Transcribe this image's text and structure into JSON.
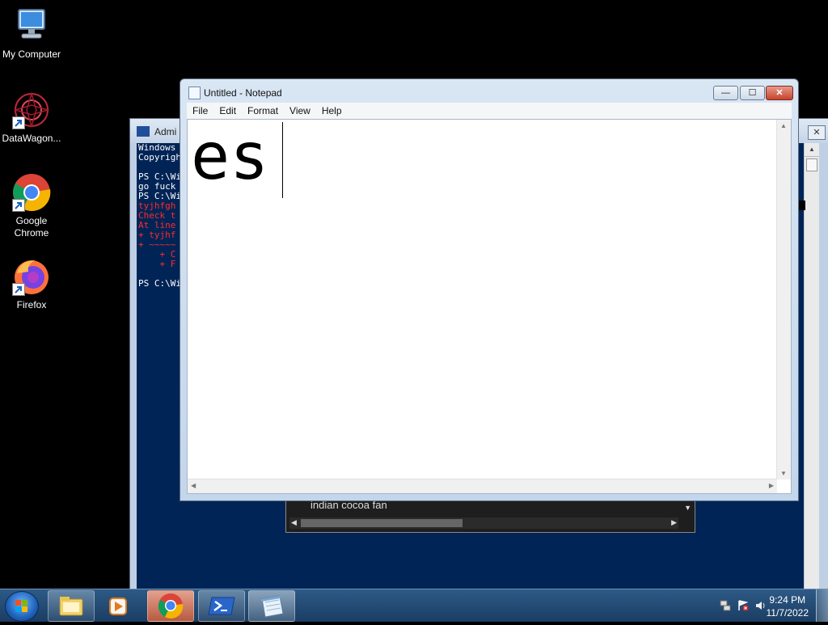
{
  "desktop": {
    "icons": [
      {
        "label": "My Computer",
        "icon": "computer-icon"
      },
      {
        "label": "DataWagon...",
        "icon": "datawagon-icon"
      },
      {
        "label": "Google Chrome",
        "icon": "chrome-icon"
      },
      {
        "label": "Firefox",
        "icon": "firefox-icon"
      }
    ]
  },
  "powershell": {
    "title": "Admi",
    "close": "✕",
    "lines": [
      {
        "text": "Windows",
        "color": "#ffffff"
      },
      {
        "text": "Copyrigh",
        "color": "#ffffff"
      },
      {
        "text": "",
        "color": "#ffffff"
      },
      {
        "text": "PS C:\\Wi",
        "color": "#ffffff"
      },
      {
        "text": "go fuck",
        "color": "#ffffff"
      },
      {
        "text": "PS C:\\Wi",
        "color": "#ffffff"
      },
      {
        "text": "tyjhfgh",
        "color": "#ff2b2b"
      },
      {
        "text": "Check t",
        "color": "#ff2b2b"
      },
      {
        "text": "At line",
        "color": "#ff2b2b"
      },
      {
        "text": "+ tyjhf",
        "color": "#ff2b2b"
      },
      {
        "text": "+ ~~~~~",
        "color": "#ff2b2b"
      },
      {
        "text": "    + C",
        "color": "#ff2b2b"
      },
      {
        "text": "    + F",
        "color": "#ff2b2b"
      },
      {
        "text": "",
        "color": "#ffffff"
      },
      {
        "text": "PS C:\\Wi",
        "color": "#ffffff"
      }
    ]
  },
  "autocomplete": {
    "text": "indian cocoa fan"
  },
  "notepad": {
    "title": "Untitled - Notepad",
    "menu": [
      "File",
      "Edit",
      "Format",
      "View",
      "Help"
    ],
    "content": "es",
    "buttons": {
      "minimize": "—",
      "maximize": "☐",
      "close": "✕"
    }
  },
  "taskbar": {
    "items": [
      {
        "name": "start",
        "icon": "windows-start-icon"
      },
      {
        "name": "explorer",
        "icon": "folder-icon"
      },
      {
        "name": "media-player",
        "icon": "media-player-icon"
      },
      {
        "name": "chrome",
        "icon": "chrome-icon"
      },
      {
        "name": "powershell",
        "icon": "powershell-icon"
      },
      {
        "name": "notepad",
        "icon": "notepad-icon"
      }
    ],
    "tray": {
      "time": "9:24 PM",
      "date": "11/7/2022"
    }
  }
}
